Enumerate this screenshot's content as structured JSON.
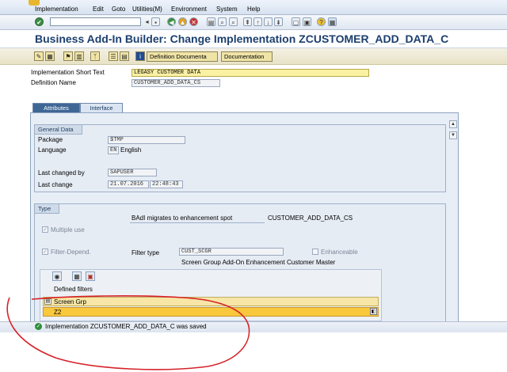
{
  "menubar": {
    "items": [
      "Implementation",
      "Edit",
      "Goto",
      "Utilities(M)",
      "Environment",
      "System",
      "Help"
    ]
  },
  "toolbar": {
    "command_value": "",
    "icons": [
      "enter-icon",
      "save-icon",
      "back-icon",
      "exit-icon",
      "cancel-icon",
      "print-icon",
      "find-icon",
      "find-next-icon",
      "first-page-icon",
      "previous-page-icon",
      "next-page-icon",
      "last-page-icon",
      "new-session-icon",
      "shortcut-icon",
      "help-icon",
      "customize-layout-icon"
    ]
  },
  "title": "Business Add-In Builder: Change Implementation ZCUSTOMER_ADD_DATA_C",
  "app_toolbar": {
    "icons": [
      "display-change-icon",
      "other-object-icon",
      "activate-icon",
      "check-icon",
      "where-used-icon",
      "object-list-icon",
      "documentation-icon",
      "info-icon"
    ],
    "definition_doc_label": "Definition Documenta",
    "documentation_label": "Documentation"
  },
  "header_fields": {
    "short_text_label": "Implementation Short Text",
    "short_text_value": "LEGASY CUSTOMER DATA",
    "definition_name_label": "Definition Name",
    "definition_name_value": "CUSTOMER_ADD_DATA_CS"
  },
  "tabs": [
    {
      "label": "Attributes",
      "active": true
    },
    {
      "label": "Interface",
      "active": false
    }
  ],
  "general_data": {
    "title": "General Data",
    "package_label": "Package",
    "package_value": "$TMP",
    "language_label": "Language",
    "language_code": "EN",
    "language_name": "English",
    "changed_by_label": "Last changed by",
    "changed_by_value": "SAPUSER",
    "last_change_label": "Last change",
    "last_change_date": "21.07.2016",
    "last_change_time": "22:48:43"
  },
  "type_group": {
    "title": "Type",
    "migrate_text": "BAdI migrates to enhancement spot",
    "migrate_value": "CUSTOMER_ADD_DATA_CS",
    "multiple_use_label": "Multiple use",
    "multiple_use_checked": true,
    "filter_depend_label": "Filter-Depend.",
    "filter_depend_checked": true,
    "filter_type_label": "Filter type",
    "filter_type_value": "CUST_SCGR",
    "enhanceable_label": "Enhanceable",
    "enhanceable_checked": false,
    "filter_desc": "Screen Group Add-On Enhancement Customer Master",
    "defined_filters_label": "Defined filters",
    "filter_column": "Screen Grp",
    "filter_rows": [
      "Z2"
    ]
  },
  "status": {
    "message": "Implementation ZCUSTOMER_ADD_DATA_C was saved",
    "type": "success",
    "color": "#2f8d3a"
  },
  "colors": {
    "title_text": "#1c3f6e",
    "active_tab": "#3f6796",
    "input_bg": "#fbf1a3",
    "annotation": "#d6222a"
  }
}
